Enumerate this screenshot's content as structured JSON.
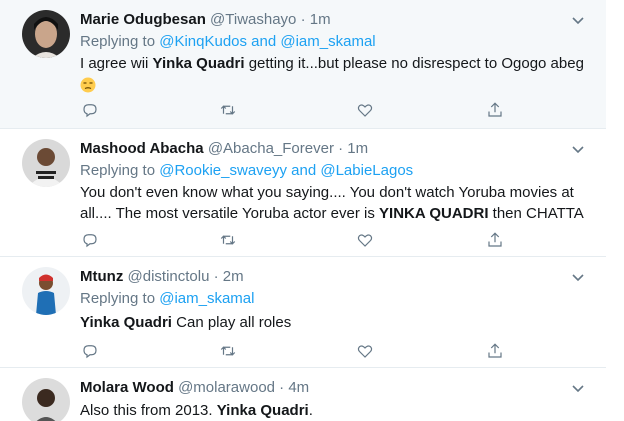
{
  "tweets": [
    {
      "name": "Marie Odugbesan",
      "handle": "@Tiwashayo",
      "dot": "·",
      "time": "1m",
      "replying_prefix": "Replying to ",
      "replying_to": "@KinqKudos and @iam_skamal",
      "text_parts": [
        "I agree wii ",
        "Yinka Quadri",
        " getting it...but please no disrespect to Ogogo abeg"
      ],
      "emoji": "😒"
    },
    {
      "name": "Mashood Abacha",
      "handle": "@Abacha_Forever",
      "dot": "·",
      "time": "1m",
      "replying_prefix": "Replying to ",
      "replying_to": "@Rookie_swaveyy and @LabieLagos",
      "line1": "You don't even know what you saying.... You don't watch Yoruba movies at",
      "line2_parts": [
        "all.... The most versatile Yoruba actor ever is ",
        "YINKA QUADRI",
        " then CHATTA"
      ]
    },
    {
      "name": "Mtunz",
      "handle": "@distinctolu",
      "dot": "·",
      "time": "2m",
      "replying_prefix": "Replying to ",
      "replying_to": "@iam_skamal",
      "text_parts": [
        "Yinka Quadri",
        " Can play all roles"
      ]
    },
    {
      "name": "Molara Wood",
      "handle": "@molarawood",
      "dot": "·",
      "time": "4m",
      "text_parts": [
        "Also this from 2013. ",
        "Yinka Quadri",
        "."
      ]
    }
  ],
  "icons": [
    "chevron-down-icon",
    "reply-icon",
    "retweet-icon",
    "like-icon",
    "share-icon"
  ],
  "colors": {
    "accent": "#1da1f2",
    "muted": "#657786",
    "text": "#14171a",
    "highlight_bg": "#f5f8fa",
    "divider": "#e6ecf0"
  }
}
